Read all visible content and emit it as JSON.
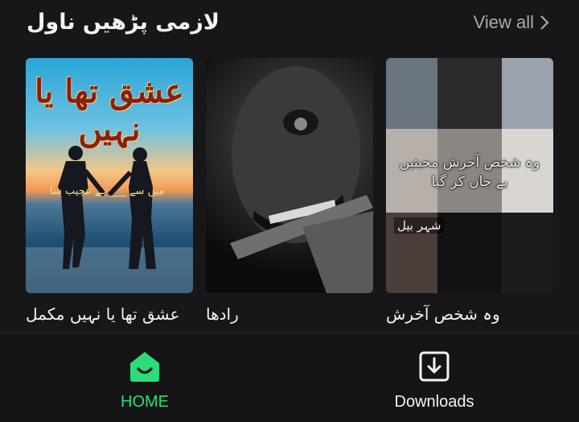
{
  "section": {
    "title": "لازمی پڑھیں ناول",
    "view_all": "View all"
  },
  "books": [
    {
      "title": "عشق تھا یا نہیں مکمل",
      "cover_text": "عشق تھا یا نہیں",
      "cover_subtext": "میں سے ___ ہے عجیب سا"
    },
    {
      "title": "رادھا"
    },
    {
      "title": "وہ شخص آخرش",
      "cover_caption": "وہ شخص آخرش محبتیں بے جاں کر گیا",
      "cover_author": "شہر بیل"
    }
  ],
  "nav": {
    "home": "HOME",
    "downloads": "Downloads"
  },
  "colors": {
    "accent": "#2bdc7a",
    "background": "#17171a",
    "muted": "#a9a9b0"
  },
  "icons": {
    "home": "home-icon",
    "downloads": "download-icon",
    "view_all": "chevron-right-icon"
  }
}
